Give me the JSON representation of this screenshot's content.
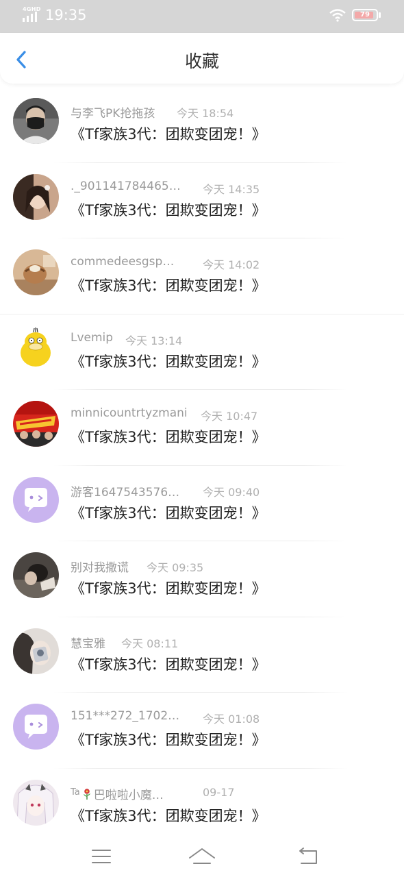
{
  "status_bar": {
    "network": "4GHD",
    "time": "19:35",
    "battery": "79"
  },
  "header": {
    "title": "收藏",
    "back_icon": "chevron-left-icon",
    "accent_color": "#3a8ee6"
  },
  "items": [
    {
      "username": "与李飞PK抢拖孩",
      "time": "今天 18:54",
      "title": "《Tf家族3代：团欺变团宠！》",
      "avatar": "photo-man-mask"
    },
    {
      "username": "._901141784465…",
      "time": "今天 14:35",
      "title": "《Tf家族3代：团欺变团宠！》",
      "avatar": "photo-girl"
    },
    {
      "username": "commedeesgsp…",
      "time": "今天 14:02",
      "title": "《Tf家族3代：团欺变团宠！》",
      "avatar": "photo-object"
    },
    {
      "username": "Lvemip",
      "time": "今天 13:14",
      "title": "《Tf家族3代：团欺变团宠！》",
      "avatar": "psyduck-cartoon"
    },
    {
      "username": "minnicountrtyzmani",
      "time": "今天 10:47",
      "title": "《Tf家族3代：团欺变团宠！》",
      "avatar": "red-poster"
    },
    {
      "username": "游客1647543576…",
      "time": "今天 09:40",
      "title": "《Tf家族3代：团欺变团宠！》",
      "avatar": "default-chat-bubble"
    },
    {
      "username": "别对我撒谎",
      "time": "今天 09:35",
      "title": "《Tf家族3代：团欺变团宠！》",
      "avatar": "photo-dark"
    },
    {
      "username": "慧宝雅",
      "time": "今天 08:11",
      "title": "《Tf家族3代：团欺变团宠！》",
      "avatar": "photo-girl-light"
    },
    {
      "username": "151***272_1702…",
      "time": "今天 01:08",
      "title": "《Tf家族3代：团欺变团宠！》",
      "avatar": "default-chat-bubble"
    },
    {
      "username_prefix": "Ta",
      "username": "巴啦啦小魔…",
      "time": "09-17",
      "title": "《Tf家族3代：团欺变团宠！》",
      "avatar": "anime-girl"
    }
  ],
  "nav": {
    "menu_icon": "menu-icon",
    "home_icon": "home-icon",
    "back_icon": "back-arrow-icon"
  }
}
